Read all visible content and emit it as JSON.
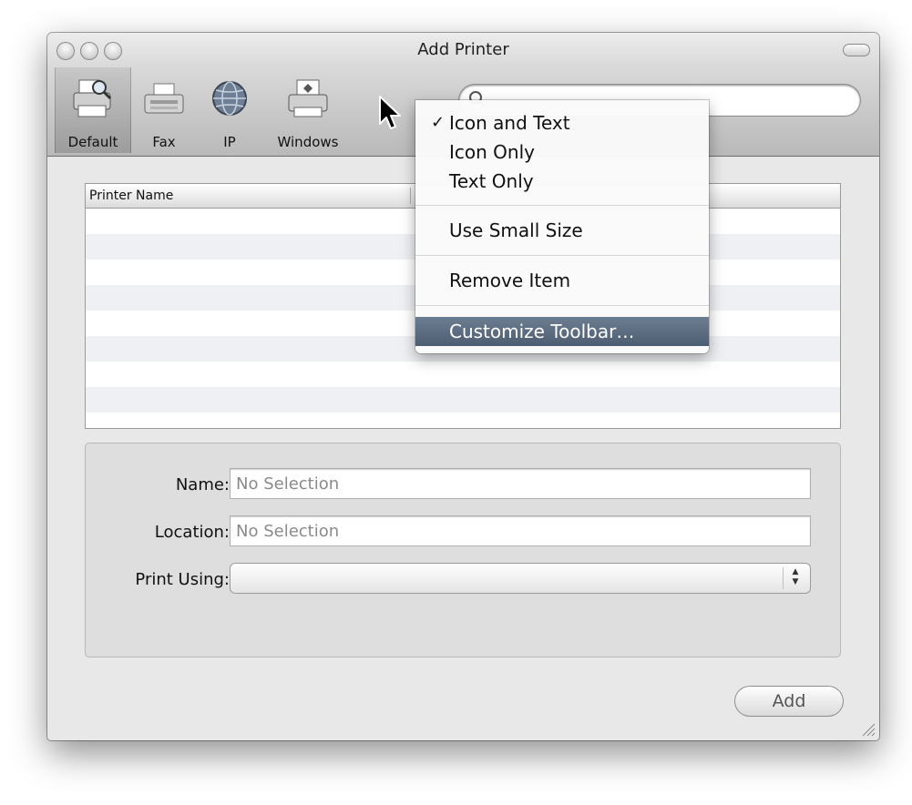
{
  "window": {
    "title": "Add Printer"
  },
  "toolbar": {
    "items": [
      {
        "label": "Default",
        "icon": "default-printer-icon",
        "selected": true
      },
      {
        "label": "Fax",
        "icon": "fax-icon"
      },
      {
        "label": "IP",
        "icon": "globe-icon"
      },
      {
        "label": "Windows",
        "icon": "windows-printer-icon"
      }
    ],
    "search_placeholder": ""
  },
  "context_menu": {
    "items": [
      {
        "label": "Icon and Text",
        "checked": true
      },
      {
        "label": "Icon Only"
      },
      {
        "label": "Text Only"
      },
      {
        "label": "Use Small Size"
      },
      {
        "label": "Remove Item"
      },
      {
        "label": "Customize Toolbar…",
        "highlighted": true
      }
    ],
    "checkmark": "✓"
  },
  "table": {
    "columns": [
      "Printer Name"
    ],
    "rows": []
  },
  "details": {
    "name_label": "Name:",
    "name_value": "No Selection",
    "location_label": "Location:",
    "location_value": "No Selection",
    "print_using_label": "Print Using:",
    "print_using_value": ""
  },
  "buttons": {
    "add": "Add"
  },
  "colors": {
    "menu_highlight": "#56667b",
    "row_alt": "#eef0f3"
  }
}
